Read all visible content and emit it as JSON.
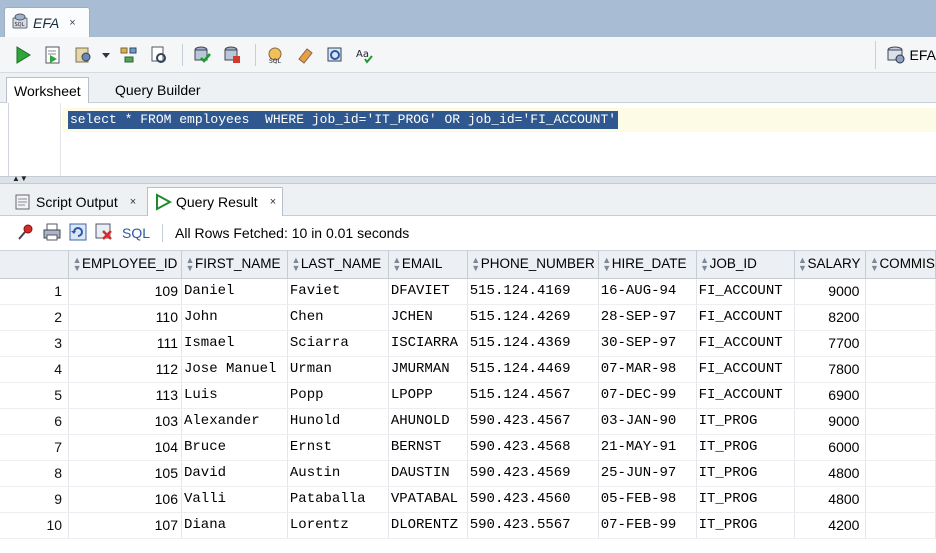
{
  "doc_tab": {
    "title": "EFA",
    "icon": "sql-sheet-icon",
    "close": "×"
  },
  "toolbar": {
    "buttons": [
      "run-statement-icon",
      "run-script-icon",
      "autotrace-icon",
      "explain-plan-icon",
      "sql-tuning-icon",
      "commit-icon",
      "rollback-icon",
      "sql-history-icon",
      "clear-icon",
      "monitor-icon",
      "format-icon"
    ],
    "connection_label": "EFA"
  },
  "subtabs": {
    "worksheet": "Worksheet",
    "query_builder": "Query Builder"
  },
  "editor": {
    "sql": "select * FROM employees  WHERE job_id='IT_PROG' OR job_id='FI_ACCOUNT'"
  },
  "output_tabs": {
    "script_output": "Script Output",
    "query_result": "Query Result",
    "close": "×"
  },
  "result_toolbar": {
    "sql_label": "SQL",
    "status": "All Rows Fetched: 10 in 0.01 seconds"
  },
  "grid": {
    "columns": [
      "EMPLOYEE_ID",
      "FIRST_NAME",
      "LAST_NAME",
      "EMAIL",
      "PHONE_NUMBER",
      "HIRE_DATE",
      "JOB_ID",
      "SALARY",
      "COMMIS"
    ],
    "rows": [
      {
        "n": "1",
        "id": "109",
        "first": "Daniel",
        "last": "Faviet",
        "email": "DFAVIET",
        "phone": "515.124.4169",
        "hire": "16-AUG-94",
        "job": "FI_ACCOUNT",
        "salary": "9000"
      },
      {
        "n": "2",
        "id": "110",
        "first": "John",
        "last": "Chen",
        "email": "JCHEN",
        "phone": "515.124.4269",
        "hire": "28-SEP-97",
        "job": "FI_ACCOUNT",
        "salary": "8200"
      },
      {
        "n": "3",
        "id": "111",
        "first": "Ismael",
        "last": "Sciarra",
        "email": "ISCIARRA",
        "phone": "515.124.4369",
        "hire": "30-SEP-97",
        "job": "FI_ACCOUNT",
        "salary": "7700"
      },
      {
        "n": "4",
        "id": "112",
        "first": "Jose Manuel",
        "last": "Urman",
        "email": "JMURMAN",
        "phone": "515.124.4469",
        "hire": "07-MAR-98",
        "job": "FI_ACCOUNT",
        "salary": "7800"
      },
      {
        "n": "5",
        "id": "113",
        "first": "Luis",
        "last": "Popp",
        "email": "LPOPP",
        "phone": "515.124.4567",
        "hire": "07-DEC-99",
        "job": "FI_ACCOUNT",
        "salary": "6900"
      },
      {
        "n": "6",
        "id": "103",
        "first": "Alexander",
        "last": "Hunold",
        "email": "AHUNOLD",
        "phone": "590.423.4567",
        "hire": "03-JAN-90",
        "job": "IT_PROG",
        "salary": "9000"
      },
      {
        "n": "7",
        "id": "104",
        "first": "Bruce",
        "last": "Ernst",
        "email": "BERNST",
        "phone": "590.423.4568",
        "hire": "21-MAY-91",
        "job": "IT_PROG",
        "salary": "6000"
      },
      {
        "n": "8",
        "id": "105",
        "first": "David",
        "last": "Austin",
        "email": "DAUSTIN",
        "phone": "590.423.4569",
        "hire": "25-JUN-97",
        "job": "IT_PROG",
        "salary": "4800"
      },
      {
        "n": "9",
        "id": "106",
        "first": "Valli",
        "last": "Pataballa",
        "email": "VPATABAL",
        "phone": "590.423.4560",
        "hire": "05-FEB-98",
        "job": "IT_PROG",
        "salary": "4800"
      },
      {
        "n": "10",
        "id": "107",
        "first": "Diana",
        "last": "Lorentz",
        "email": "DLORENTZ",
        "phone": "590.423.5567",
        "hire": "07-FEB-99",
        "job": "IT_PROG",
        "salary": "4200"
      }
    ]
  },
  "colors": {
    "selection": "#2f5890",
    "current_line": "#fdfbe6",
    "top_bar": "#a8bdd4",
    "sql_link": "#2a5aa8"
  }
}
